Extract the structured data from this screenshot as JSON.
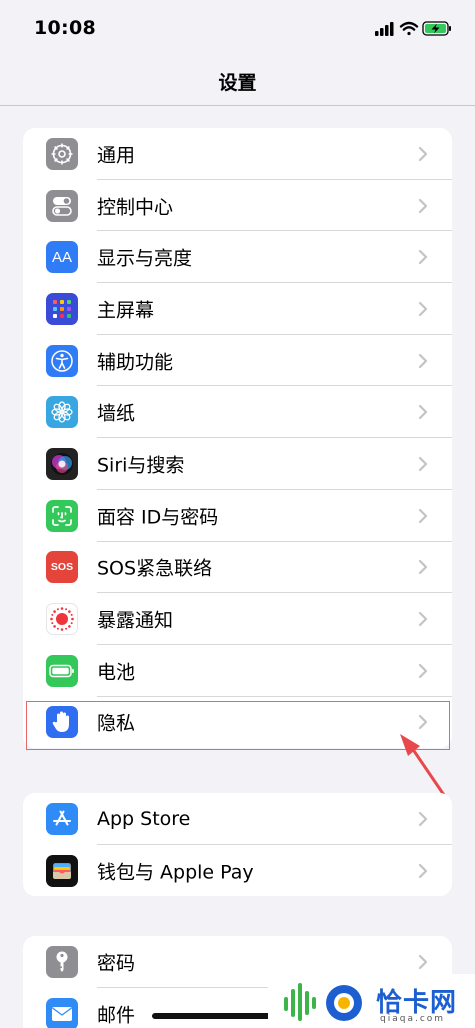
{
  "status_bar": {
    "time": "10:08"
  },
  "nav": {
    "title": "设置"
  },
  "group1": [
    {
      "label": "通用",
      "icon": "gear-icon",
      "color": "#8e8e93"
    },
    {
      "label": "控制中心",
      "icon": "toggle-icon",
      "color": "#8e8e93"
    },
    {
      "label": "显示与亮度",
      "icon": "text-size-icon",
      "color": "#2f7cf6",
      "icon_text": "AA"
    },
    {
      "label": "主屏幕",
      "icon": "home-screen-grid-icon",
      "color": "#3a4bd8"
    },
    {
      "label": "辅助功能",
      "icon": "accessibility-icon",
      "color": "#2f7cf6"
    },
    {
      "label": "墙纸",
      "icon": "flower-icon",
      "color": "#38a6e0"
    },
    {
      "label": "Siri与搜索",
      "icon": "siri-icon",
      "color": "#222222"
    },
    {
      "label": "面容 ID与密码",
      "icon": "face-id-icon",
      "color": "#34c759"
    },
    {
      "label": "SOS紧急联络",
      "icon": "sos-icon",
      "color": "#e5443a",
      "icon_text": "SOS"
    },
    {
      "label": "暴露通知",
      "icon": "exposure-notification-icon",
      "color": "#ffffff"
    },
    {
      "label": "电池",
      "icon": "battery-icon",
      "color": "#34c759"
    },
    {
      "label": "隐私",
      "icon": "hand-icon",
      "color": "#2f6ef0"
    }
  ],
  "group2": [
    {
      "label": "App Store",
      "icon": "app-store-icon",
      "color": "#2f8cf6"
    },
    {
      "label": "钱包与 Apple Pay",
      "icon": "wallet-icon",
      "color": "#111111"
    }
  ],
  "group3": [
    {
      "label": "密码",
      "icon": "key-icon",
      "color": "#8e8e93"
    },
    {
      "label": "邮件",
      "icon": "mail-icon",
      "color": "#2f8cf6"
    }
  ],
  "watermark": {
    "text": "恰卡网",
    "sub": "qiaqa.com"
  }
}
